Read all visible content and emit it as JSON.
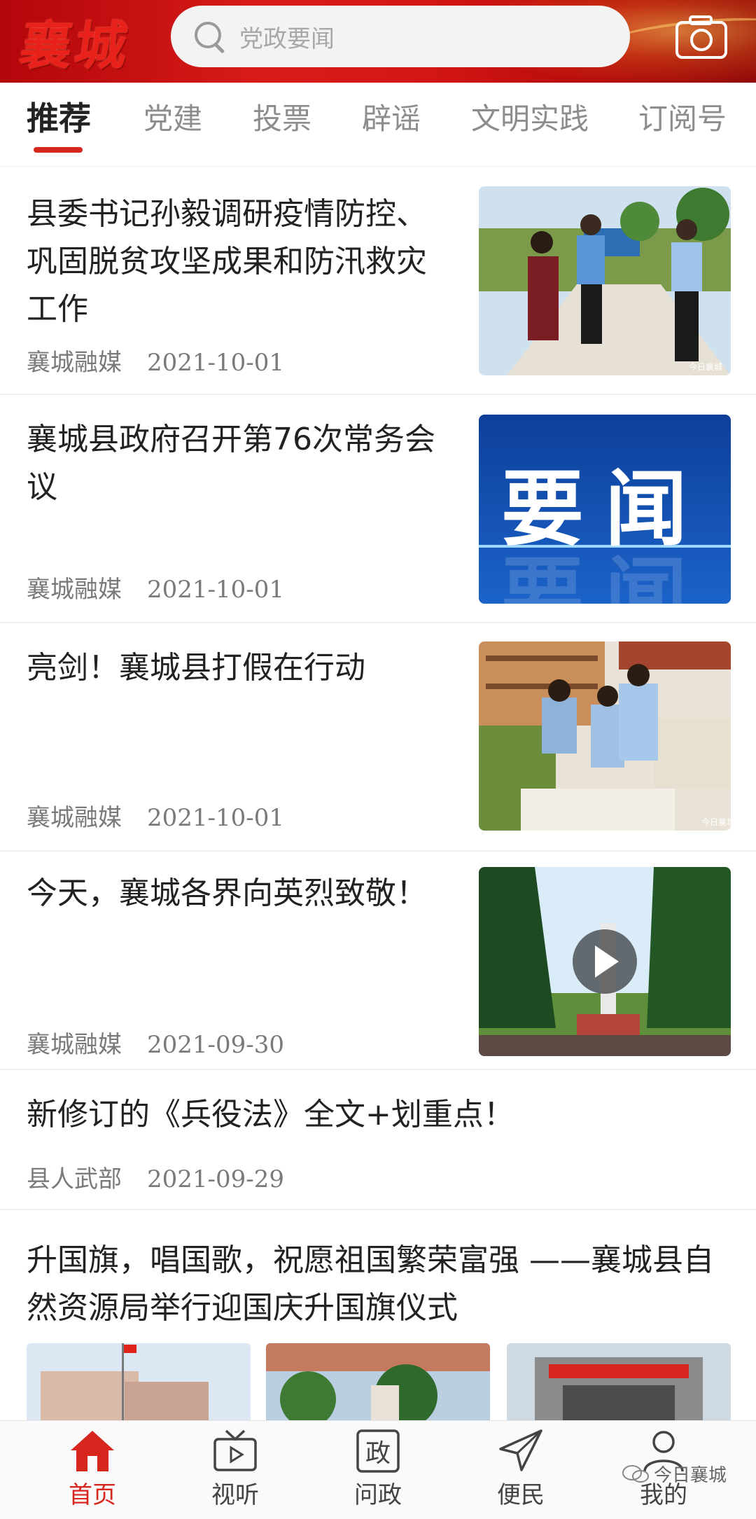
{
  "header": {
    "logo_text": "襄城",
    "search_placeholder": "党政要闻",
    "accent_color": "#d7261e"
  },
  "tabs": [
    {
      "label": "推荐",
      "active": true
    },
    {
      "label": "党建",
      "active": false
    },
    {
      "label": "投票",
      "active": false
    },
    {
      "label": "辟谣",
      "active": false
    },
    {
      "label": "文明实践",
      "active": false
    },
    {
      "label": "订阅号",
      "active": false
    }
  ],
  "feed": [
    {
      "title": "县委书记孙毅调研疫情防控、巩固脱贫攻坚成果和防汛救灾工作",
      "source": "襄城融媒",
      "date": "2021-10-01",
      "image_watermark": "今日襄城"
    },
    {
      "title": "襄城县政府召开第76次常务会议",
      "source": "襄城融媒",
      "date": "2021-10-01",
      "image_text": "要闻"
    },
    {
      "title": "亮剑！襄城县打假在行动",
      "source": "襄城融媒",
      "date": "2021-10-01",
      "image_watermark": "今日襄城"
    },
    {
      "title": "今天，襄城各界向英烈致敬！",
      "source": "襄城融媒",
      "date": "2021-09-30",
      "has_video": true
    },
    {
      "title": "新修订的《兵役法》全文+划重点！",
      "source": "县人武部",
      "date": "2021-09-29"
    },
    {
      "title": "升国旗，唱国歌，祝愿祖国繁荣富强 ——襄城县自然资源局举行迎国庆升国旗仪式"
    }
  ],
  "bottom_nav": [
    {
      "label": "首页",
      "icon": "home-icon",
      "active": true
    },
    {
      "label": "视听",
      "icon": "tv-play-icon",
      "active": false
    },
    {
      "label": "问政",
      "icon": "zheng-icon",
      "active": false
    },
    {
      "label": "便民",
      "icon": "send-icon",
      "active": false
    },
    {
      "label": "我的",
      "icon": "user-icon",
      "active": false
    }
  ],
  "watermark": "今日襄城"
}
